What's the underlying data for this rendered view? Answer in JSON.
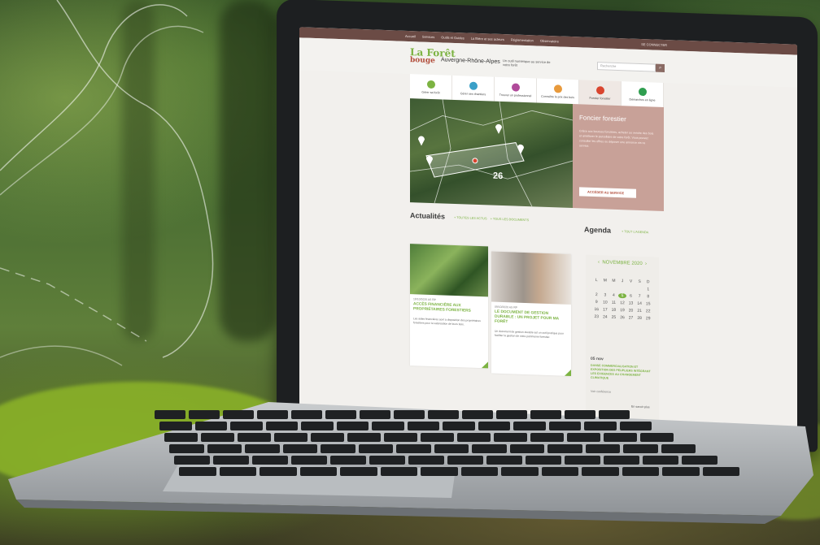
{
  "site": {
    "topbar": {
      "links": [
        "Accueil",
        "Services",
        "Outils et Guides",
        "La filière et ses acteurs",
        "Réglementation",
        "Observatoire"
      ],
      "login": "SE CONNECTER"
    },
    "logo_top": "La Forêt",
    "logo_bottom": "bouge",
    "region": "Auvergne-Rhône-Alpes",
    "tagline": "Un outil numérique au service de votre forêt",
    "search_placeholder": "Recherche",
    "nav": [
      {
        "label": "Gérer sa forêt",
        "color": "#7cb342"
      },
      {
        "label": "Gérer ses chantiers",
        "color": "#3aa0c8"
      },
      {
        "label": "Trouver un professionnel",
        "color": "#b04a9a"
      },
      {
        "label": "Connaître le prix des bois",
        "color": "#e89a3c"
      },
      {
        "label": "Foncier forestier",
        "color": "#d9452f"
      },
      {
        "label": "Démarches en ligne",
        "color": "#2f9e4f"
      }
    ],
    "hero_count": "26",
    "panel": {
      "title": "Foncier forestier",
      "text": "Grâce aux bourses foncières, acheter ou vendre des bois et améliorer le parcellaire de votre forêt. Vous pouvez consulter les offres ou déposer une annonce via ce service.",
      "button": "ACCÉDER AU SERVICE"
    },
    "news": {
      "title": "Actualités",
      "link_all": "+ TOUTES LES ACTUS",
      "link_docs": "+ TOUS LES DOCUMENTS",
      "cards": [
        {
          "date": "18/10/2020 AS RP",
          "title": "ACCÈS FINANCIÈRE AUX PROPRIÉTAIRES FORESTIERS",
          "text": "Les aides financières sont à disposition des propriétaires forestiers pour la valorisation de leurs bois."
        },
        {
          "date": "09/10/2020 AS RP",
          "title": "LE DOCUMENT DE GESTION DURABLE : UN PROJET POUR MA FORÊT",
          "text": "Un document de gestion durable est un outil pratique pour faciliter la gestion de votre patrimoine forestier."
        }
      ]
    },
    "agenda": {
      "title": "Agenda",
      "link": "+ TOUT L'AGENDA",
      "month": "NOVEMBRE 2020",
      "weekdays": [
        "L",
        "M",
        "M",
        "J",
        "V",
        "S",
        "D"
      ],
      "days": [
        "",
        "",
        "",
        "",
        "",
        "",
        "1",
        "2",
        "3",
        "4",
        "5",
        "6",
        "7",
        "8",
        "9",
        "10",
        "11",
        "12",
        "13",
        "14",
        "15",
        "16",
        "17",
        "18",
        "19",
        "20",
        "21",
        "22",
        "23",
        "24",
        "25",
        "26",
        "27",
        "28",
        "29"
      ],
      "today": "5",
      "event_date": "05 nov",
      "event_title": "DANSE COMMERCIALISATION ET EXPOSITION DES PEUPLIERS INTÉGRANT LES EXIGENCES AU CHANGEMENT CLIMATIQUE",
      "event_more": "Voir conférence",
      "see_all": "En savoir plus"
    }
  },
  "colors": {
    "brand_green": "#7cb342",
    "brand_red": "#b24d3b",
    "topbar": "#6b4b45",
    "panel": "#c8a198"
  }
}
